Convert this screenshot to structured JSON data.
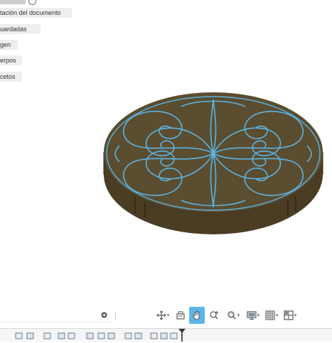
{
  "browser": {
    "items": [
      {
        "label": "tación del documento"
      },
      {
        "label": "uardadas"
      },
      {
        "label": "gen"
      },
      {
        "label": "erpos"
      },
      {
        "label": "cetos"
      }
    ]
  },
  "viewport": {
    "model_color": "#5b4d2f",
    "sketch_color": "#5ab4e6"
  },
  "statusbar": {
    "search_value": ""
  },
  "nav_toolbar": {
    "icons": [
      "orbit-icon",
      "look-at-icon",
      "pan-icon",
      "zoom-icon",
      "fit-icon",
      "display-settings-icon",
      "grid-icon",
      "viewports-icon"
    ],
    "active": "pan-icon"
  },
  "timeline": {
    "items": 13
  }
}
